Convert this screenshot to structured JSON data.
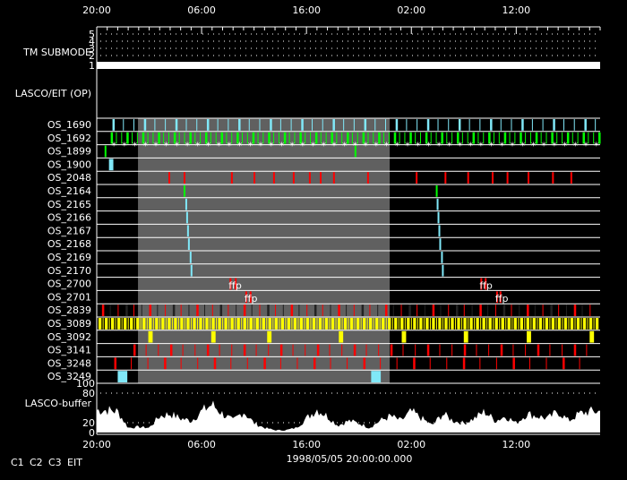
{
  "chart_data": {
    "type": "timeline",
    "start": "1998/05/05 20:00",
    "end": "1998/05/07 20:00",
    "date_label": "1998/05/05 20:00:00.000",
    "time_ticks": [
      "20:00",
      "06:00",
      "16:00",
      "02:00",
      "12:00"
    ],
    "colors": {
      "C1": "#ff0000",
      "C2": "#00ff00",
      "C3": "#80e8f8",
      "EIT": "#ffff00",
      "shade": "#606060"
    },
    "legend": [
      {
        "label": "C1",
        "color": "#ff0000"
      },
      {
        "label": "C2",
        "color": "#00ff00"
      },
      {
        "label": "C3",
        "color": "#80e8f8"
      },
      {
        "label": "EIT",
        "color": "#ffff00"
      }
    ],
    "shaded_interval": [
      "05/05 23:56",
      "05/06 23:56"
    ],
    "tm_submode": {
      "label": "TM SUBMODE",
      "levels": [
        "1",
        "2",
        "3",
        "4",
        "5"
      ],
      "value": 1
    },
    "op_label": "LASCO/EIT (OP)",
    "rows": [
      {
        "name": "OS_1690",
        "color": "C3",
        "periodic": {
          "from": "05/05 21:30",
          "to": "05/07 19:30",
          "every_min": 60
        }
      },
      {
        "name": "OS_1692",
        "color": "C2",
        "periodic": {
          "from": "05/05 21:20",
          "to": "05/07 19:50",
          "every_min": 30
        },
        "asterisk_every_min": 60
      },
      {
        "name": "OS_1899",
        "color": "C2",
        "events": [
          "05/05 20:45",
          "05/06 20:35"
        ]
      },
      {
        "name": "OS_1900",
        "color": "C3",
        "blocks": [
          [
            "05/05 21:10",
            "05/05 21:35"
          ]
        ]
      },
      {
        "name": "OS_2048",
        "color": "C1",
        "events": [
          "05/06 02:50",
          "05/06 04:17",
          "05/06 08:48",
          "05/06 10:57",
          "05/06 12:49",
          "05/06 14:42",
          "05/06 16:14",
          "05/06 17:16",
          "05/06 18:32",
          "05/06 21:47",
          "05/07 02:25",
          "05/07 05:10",
          "05/07 07:20",
          "05/07 09:40",
          "05/07 11:05",
          "05/07 13:05",
          "05/07 15:25",
          "05/07 17:10"
        ]
      },
      {
        "name": "OS_2164",
        "color": "C2",
        "events": [
          "05/06 04:17",
          "05/07 04:20"
        ]
      },
      {
        "name": "OS_2165",
        "color": "C3",
        "events": [
          "05/06 04:27",
          "05/07 04:25"
        ]
      },
      {
        "name": "OS_2166",
        "color": "C3",
        "events": [
          "05/06 04:32",
          "05/07 04:30"
        ]
      },
      {
        "name": "OS_2167",
        "color": "C3",
        "events": [
          "05/06 04:37",
          "05/07 04:35"
        ]
      },
      {
        "name": "OS_2168",
        "color": "C3",
        "events": [
          "05/06 04:42",
          "05/07 04:40"
        ]
      },
      {
        "name": "OS_2169",
        "color": "C3",
        "events": [
          "05/06 04:52",
          "05/07 04:50"
        ]
      },
      {
        "name": "OS_2170",
        "color": "C3",
        "events": [
          "05/06 04:57",
          "05/07 04:55"
        ]
      },
      {
        "name": "OS_2700",
        "color": "C1",
        "events": [
          "05/06 08:40",
          "05/06 09:10",
          "05/07 08:35",
          "05/07 09:00"
        ],
        "annotation": "ffp"
      },
      {
        "name": "OS_2701",
        "color": "C1",
        "events": [
          "05/06 10:10",
          "05/06 10:35",
          "05/07 10:05",
          "05/07 10:25"
        ],
        "annotation": "ffp"
      },
      {
        "name": "OS_2839",
        "color": "C1",
        "periodic": {
          "from": "05/05 20:30",
          "to": "05/07 19:30",
          "every_min": 45
        }
      },
      {
        "name": "OS_3089",
        "color": "EIT",
        "periodic": {
          "from": "05/05 20:10",
          "to": "05/07 19:50",
          "every_min": 12
        }
      },
      {
        "name": "OS_3092",
        "color": "EIT",
        "blocks": [
          [
            "05/06 00:55",
            "05/06 01:20"
          ],
          [
            "05/06 06:55",
            "05/06 07:20"
          ],
          [
            "05/06 12:15",
            "05/06 12:40"
          ],
          [
            "05/06 19:05",
            "05/06 19:30"
          ],
          [
            "05/07 01:05",
            "05/07 01:30"
          ],
          [
            "05/07 07:00",
            "05/07 07:25"
          ],
          [
            "05/07 13:00",
            "05/07 13:25"
          ],
          [
            "05/07 19:00",
            "05/07 19:25"
          ]
        ]
      },
      {
        "name": "OS_3141",
        "color": "C1",
        "periodic": {
          "from": "05/05 23:30",
          "to": "05/07 19:00",
          "every_min": 70
        }
      },
      {
        "name": "OS_3248",
        "color": "C1",
        "periodic": {
          "from": "05/05 21:40",
          "to": "05/07 19:00",
          "every_min": 95
        }
      },
      {
        "name": "OS_3249",
        "color": "C3",
        "blocks": [
          [
            "05/05 22:00",
            "05/05 22:55"
          ],
          [
            "05/06 22:10",
            "05/06 23:05"
          ]
        ]
      }
    ],
    "buffer": {
      "label": "LASCO-buffer",
      "y_ticks": [
        "0",
        "20",
        "80",
        "100"
      ],
      "ylim": [
        0,
        100
      ],
      "hourly_values": [
        48,
        48,
        45,
        10,
        12,
        10,
        35,
        40,
        30,
        25,
        45,
        60,
        40,
        25,
        45,
        20,
        10,
        5,
        5,
        10,
        30,
        50,
        35,
        15,
        25,
        20,
        10,
        25,
        35,
        25,
        45,
        30,
        15,
        40,
        25,
        20,
        30,
        45,
        25,
        35,
        20,
        40,
        35,
        30,
        45,
        25,
        40,
        45
      ]
    }
  }
}
